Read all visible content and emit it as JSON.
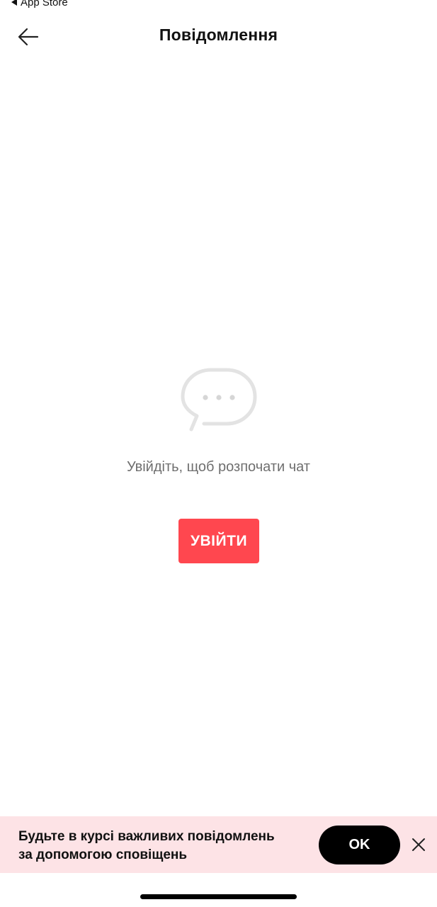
{
  "status_bar": {
    "back_app": "App Store"
  },
  "header": {
    "title": "Повідомлення",
    "back_icon": "arrow-left-icon"
  },
  "empty_state": {
    "icon": "chat-bubble-icon",
    "message": "Увійдіть, щоб розпочати чат",
    "login_label": "УВІЙТИ"
  },
  "notification_banner": {
    "line1": "Будьте в курсі важливих повідомлень",
    "line2": "за допомогою сповіщень",
    "ok_label": "OK",
    "close_icon": "close-icon"
  },
  "colors": {
    "accent": "#ff474f",
    "banner_bg": "#fde3e6",
    "ok_button": "#000000",
    "muted_text": "#6f6f6f"
  }
}
